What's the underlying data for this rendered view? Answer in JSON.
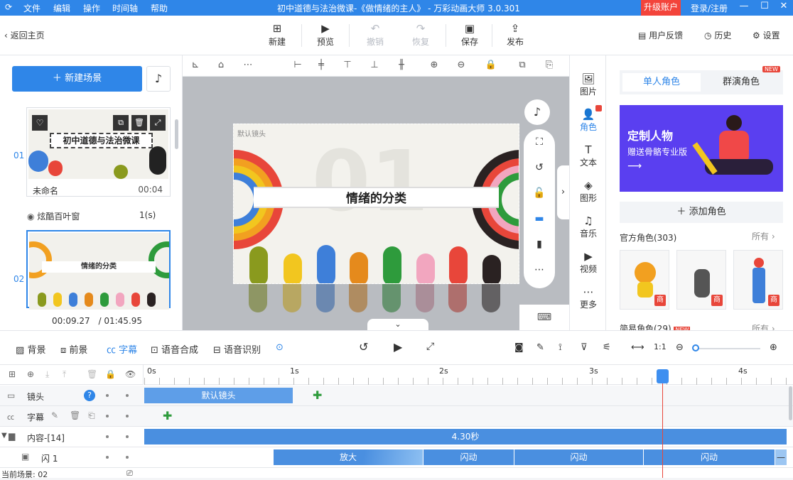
{
  "titlebar": {
    "menus": [
      "文件",
      "编辑",
      "操作",
      "时间轴",
      "帮助"
    ],
    "title": "初中道德与法治微课-《做情绪的主人》 - 万彩动画大师 3.0.301",
    "upgrade": "升级账户",
    "login": "登录/注册"
  },
  "toolbar": {
    "back": "返回主页",
    "new": "新建",
    "preview": "预览",
    "undo": "撤销",
    "redo": "恢复",
    "save": "保存",
    "publish": "发布",
    "feedback": "用户反馈",
    "history": "历史",
    "settings": "设置"
  },
  "left": {
    "new_scene": "新建场景",
    "scenes": [
      {
        "num": "01",
        "name": "未命名",
        "duration": "00:04",
        "thumb_title": "初中道德与法治微课"
      },
      {
        "num": "02",
        "thumb_title": "情绪的分类"
      }
    ],
    "transition": {
      "name": "炫酷百叶窗",
      "duration": "1(s)"
    },
    "time_current": "00:09.27",
    "time_total": "/ 01:45.95"
  },
  "canvas": {
    "camera_label": "默认镜头",
    "stage_title": "情绪的分类",
    "bg_number": "01",
    "colors": {
      "accent": "#2f86e8",
      "blob_colors": [
        "#8a9a1e",
        "#f2c61f",
        "#3e7fd9",
        "#e58a1c",
        "#2e9b3c",
        "#f2a6bf",
        "#e8463a",
        "#2a2222"
      ]
    }
  },
  "iconcol": [
    {
      "label": "图片",
      "icon": "image-icon"
    },
    {
      "label": "角色",
      "icon": "person-icon",
      "active": true
    },
    {
      "label": "文本",
      "icon": "text-icon"
    },
    {
      "label": "图形",
      "icon": "shape-icon"
    },
    {
      "label": "音乐",
      "icon": "music-icon"
    },
    {
      "label": "视频",
      "icon": "video-icon"
    },
    {
      "label": "更多",
      "icon": "more-icon"
    }
  ],
  "right": {
    "tab_single": "单人角色",
    "tab_group": "群演角色",
    "new_badge": "NEW",
    "banner_title": "定制人物",
    "banner_subtitle": "赠送骨骼专业版",
    "add_role": "添加角色",
    "official": "官方角色(303)",
    "all": "所有",
    "simple": "简易角色(29)",
    "role_badge": "商"
  },
  "timeline": {
    "tools": {
      "background": "背景",
      "foreground": "前景",
      "subtitle": "字幕",
      "tts": "语音合成",
      "asr": "语音识别"
    },
    "ticks": [
      "0s",
      "1s",
      "2s",
      "3s",
      "4s"
    ],
    "tracks": [
      {
        "name": "镜头",
        "clip": "默认镜头"
      },
      {
        "name": "字幕"
      },
      {
        "name": "内容-[14]",
        "clip": "4.30秒"
      },
      {
        "name": "闪 1",
        "clips": [
          "放大",
          "闪动",
          "闪动",
          "闪动"
        ]
      }
    ],
    "current_scene": "当前场景: 02"
  }
}
